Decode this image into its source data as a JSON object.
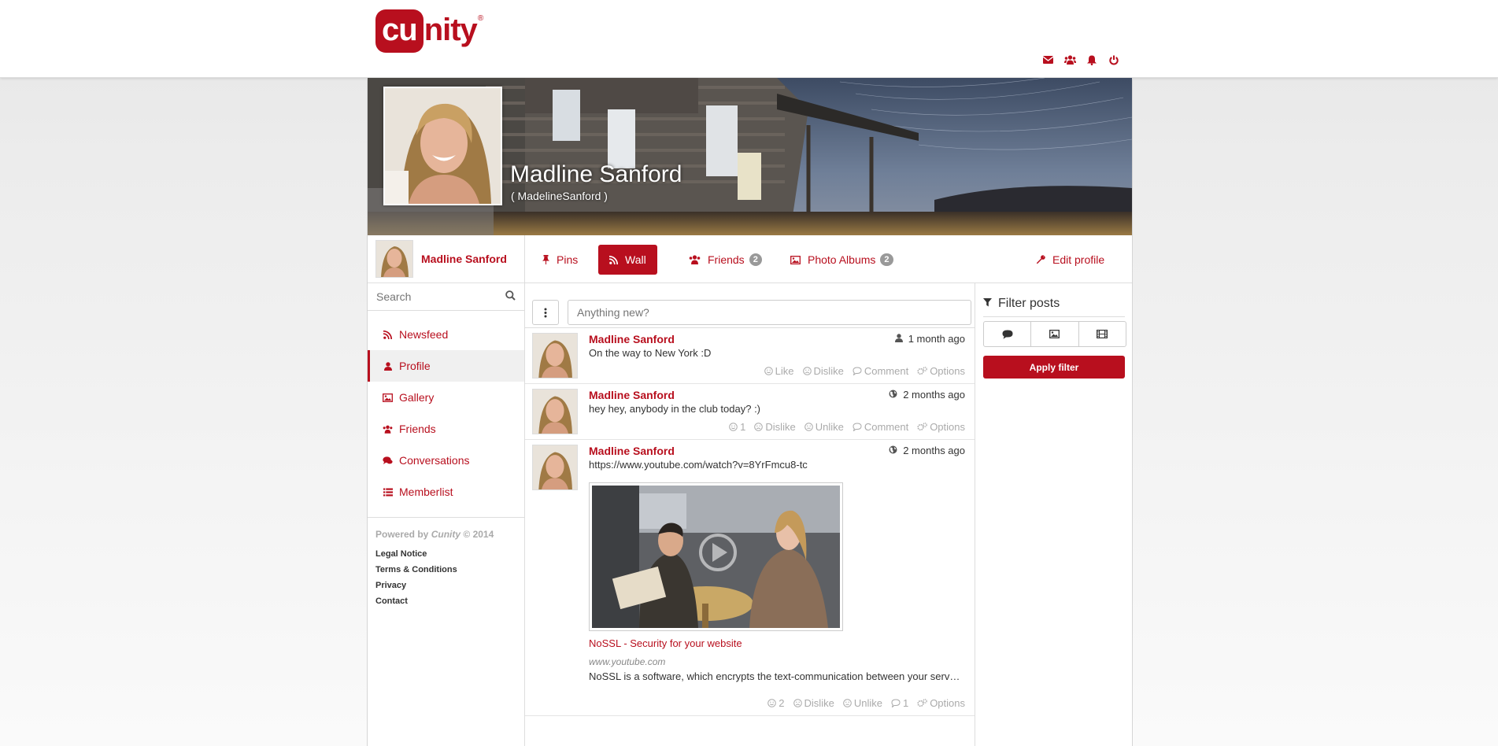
{
  "brand": {
    "logo_cu": "cu",
    "logo_nity": "nity",
    "logo_reg": "®"
  },
  "header_icons": [
    "envelope-icon",
    "users-icon",
    "bell-icon",
    "power-icon"
  ],
  "profile": {
    "name": "Madline Sanford",
    "username": "( MadelineSanford )"
  },
  "sidebar": {
    "user_name": "Madline Sanford",
    "search_placeholder": "Search",
    "nav": [
      {
        "label": "Newsfeed",
        "icon": "rss-icon"
      },
      {
        "label": "Profile",
        "icon": "user-icon",
        "active": true
      },
      {
        "label": "Gallery",
        "icon": "image-icon"
      },
      {
        "label": "Friends",
        "icon": "users-icon"
      },
      {
        "label": "Conversations",
        "icon": "comments-icon"
      },
      {
        "label": "Memberlist",
        "icon": "list-icon"
      }
    ],
    "powered_prefix": "Powered by",
    "powered_brand": "Cunity",
    "powered_suffix": "© 2014",
    "footer_links": [
      "Legal Notice",
      "Terms & Conditions",
      "Privacy",
      "Contact"
    ]
  },
  "tabs": {
    "pins": "Pins",
    "wall": "Wall",
    "friends": "Friends",
    "friends_count": "2",
    "albums": "Photo Albums",
    "albums_count": "2",
    "edit": "Edit profile"
  },
  "composer": {
    "placeholder": "Anything new?"
  },
  "posts": [
    {
      "author": "Madline Sanford",
      "time": "1 month ago",
      "privacy_icon": "user-icon",
      "text": "On the way to New York :D",
      "actions": [
        "Like",
        "Dislike",
        "Comment",
        "Options"
      ]
    },
    {
      "author": "Madline Sanford",
      "time": "2 months ago",
      "privacy_icon": "globe-icon",
      "text": "hey hey, anybody in the club today? :)",
      "likes": "1",
      "actions": [
        "Dislike",
        "Unlike",
        "Comment",
        "Options"
      ]
    },
    {
      "author": "Madline Sanford",
      "time": "2 months ago",
      "privacy_icon": "globe-icon",
      "text": "https://www.youtube.com/watch?v=8YrFmcu8-tc",
      "video_title": "NoSSL - Security for your website",
      "video_site": "www.youtube.com",
      "video_desc": "NoSSL is a software, which encrypts the text-communication between your server and the browser...",
      "likes": "2",
      "comments": "1",
      "actions": [
        "Dislike",
        "Unlike",
        "Options"
      ]
    }
  ],
  "filter": {
    "title": "Filter posts",
    "apply": "Apply filter",
    "buttons": [
      "comment-icon",
      "image-icon",
      "film-icon"
    ]
  },
  "colors": {
    "accent": "#b80f1e",
    "muted": "#aaaaaa"
  }
}
